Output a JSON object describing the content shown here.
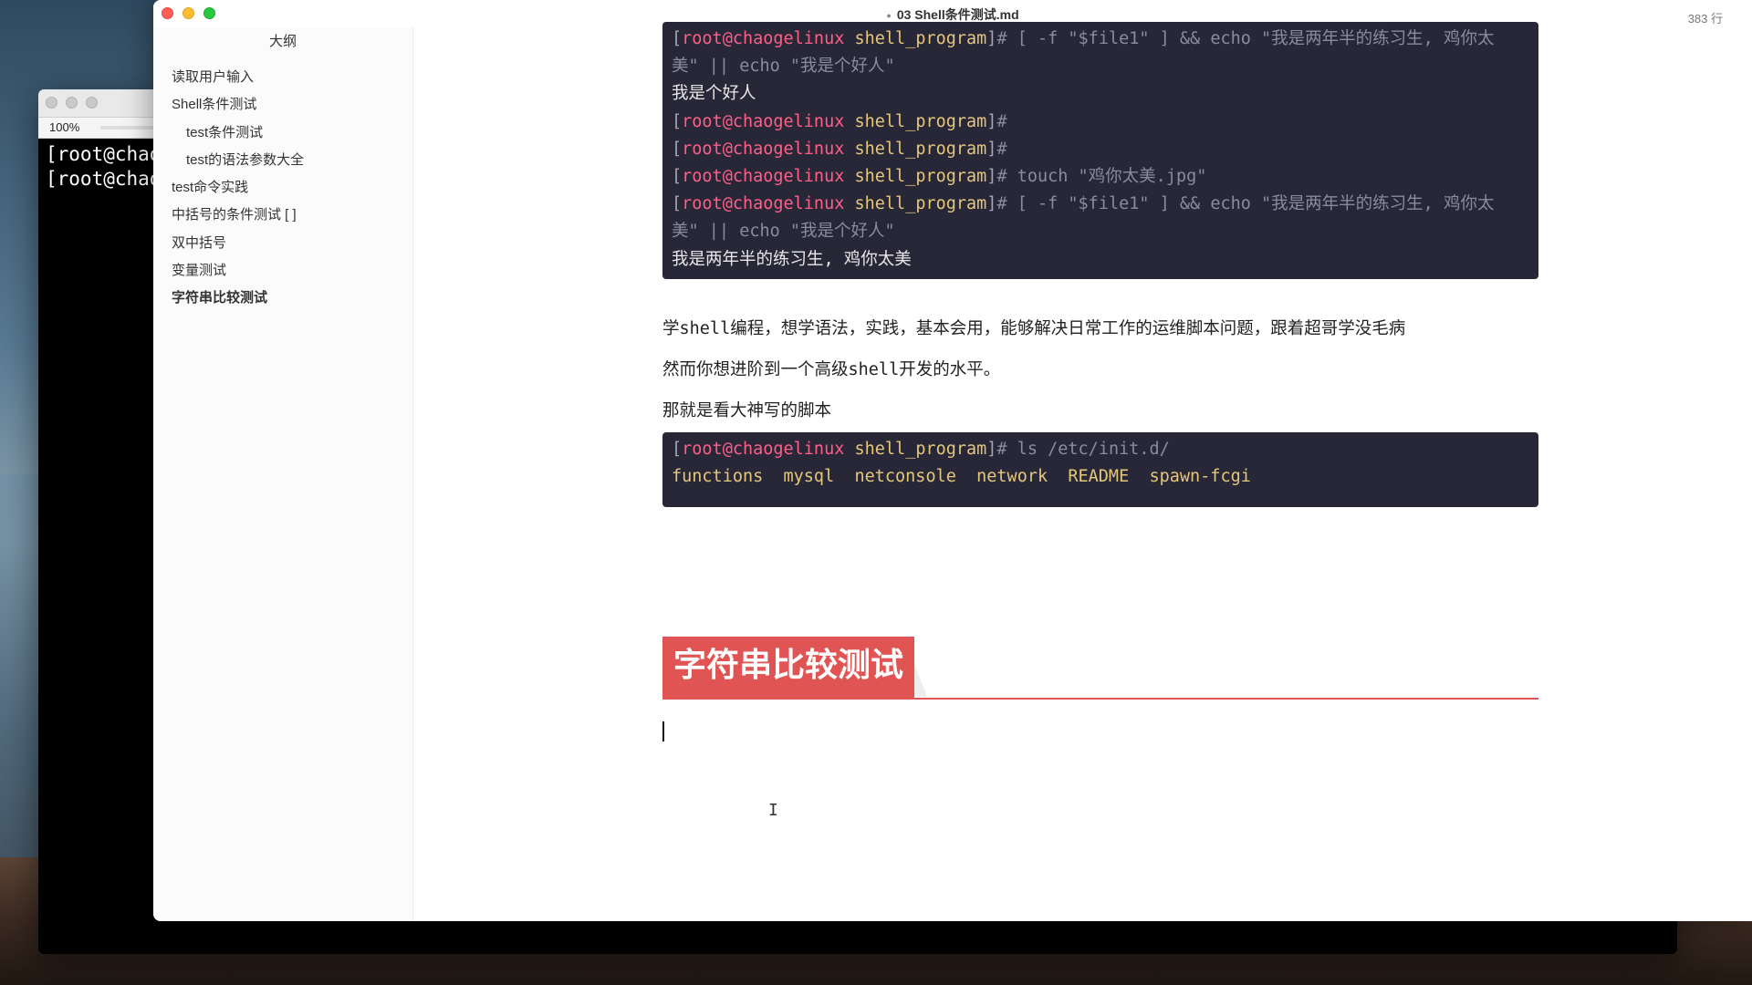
{
  "background_terminal": {
    "zoom": "100%",
    "lines": [
      "[root@chaoge",
      "[root@chaoge"
    ]
  },
  "window": {
    "title": "03 Shell条件测试.md",
    "line_count": "383 行"
  },
  "sidebar": {
    "title": "大纲",
    "items": [
      {
        "label": "读取用户输入",
        "level": 1
      },
      {
        "label": "Shell条件测试",
        "level": 1
      },
      {
        "label": "test条件测试",
        "level": 2
      },
      {
        "label": "test的语法参数大全",
        "level": 2
      },
      {
        "label": "test命令实践",
        "level": 1
      },
      {
        "label": "中括号的条件测试 [ ]",
        "level": 1
      },
      {
        "label": "双中括号",
        "level": 1
      },
      {
        "label": "变量测试",
        "level": 1
      },
      {
        "label": "字符串比较测试",
        "level": 1,
        "active": true
      }
    ]
  },
  "code_block_1": {
    "lines": [
      {
        "prompt": true,
        "user": "root@chaogelinux",
        "path": "shell_program",
        "cmd": "# [ -f \"$file1\" ] && echo \"我是两年半的练习生, 鸡你太"
      },
      {
        "text": "美\" || echo \"我是个好人\"",
        "style": "cmd"
      },
      {
        "text": "我是个好人",
        "style": "out"
      },
      {
        "prompt": true,
        "user": "root@chaogelinux",
        "path": "shell_program",
        "cmd": "#"
      },
      {
        "prompt": true,
        "user": "root@chaogelinux",
        "path": "shell_program",
        "cmd": "#"
      },
      {
        "prompt": true,
        "user": "root@chaogelinux",
        "path": "shell_program",
        "cmd": "# touch \"鸡你太美.jpg\""
      },
      {
        "prompt": true,
        "user": "root@chaogelinux",
        "path": "shell_program",
        "cmd": "# [ -f \"$file1\" ] && echo \"我是两年半的练习生, 鸡你太"
      },
      {
        "text": "美\" || echo \"我是个好人\"",
        "style": "cmd"
      },
      {
        "text": "我是两年半的练习生, 鸡你太美",
        "style": "out"
      }
    ]
  },
  "paragraphs": {
    "p1": {
      "a": "学",
      "b": "shell",
      "c": "编程，想学语法，实践，基本会用，能够解决日常工作的运维脚本问题，跟着超哥学没毛病"
    },
    "p2": {
      "a": "然而你想进阶到一个高级",
      "b": "shell",
      "c": "开发的水平。"
    },
    "p3": "那就是看大神写的脚本"
  },
  "code_block_2": {
    "prompt": {
      "user": "root@chaogelinux",
      "path": "shell_program",
      "cmd": "# ls /etc/init.d/"
    },
    "output": "functions  mysql  netconsole  network  README  spawn-fcgi"
  },
  "heading": "字符串比较测试",
  "colors": {
    "heading_bg": "#e05454",
    "code_bg": "#272738",
    "prompt_user": "#ff5f87",
    "prompt_path": "#e5c77a"
  },
  "icons": [
    "close-traffic-light",
    "minimize-traffic-light",
    "maximize-traffic-light",
    "text-cursor-icon"
  ]
}
